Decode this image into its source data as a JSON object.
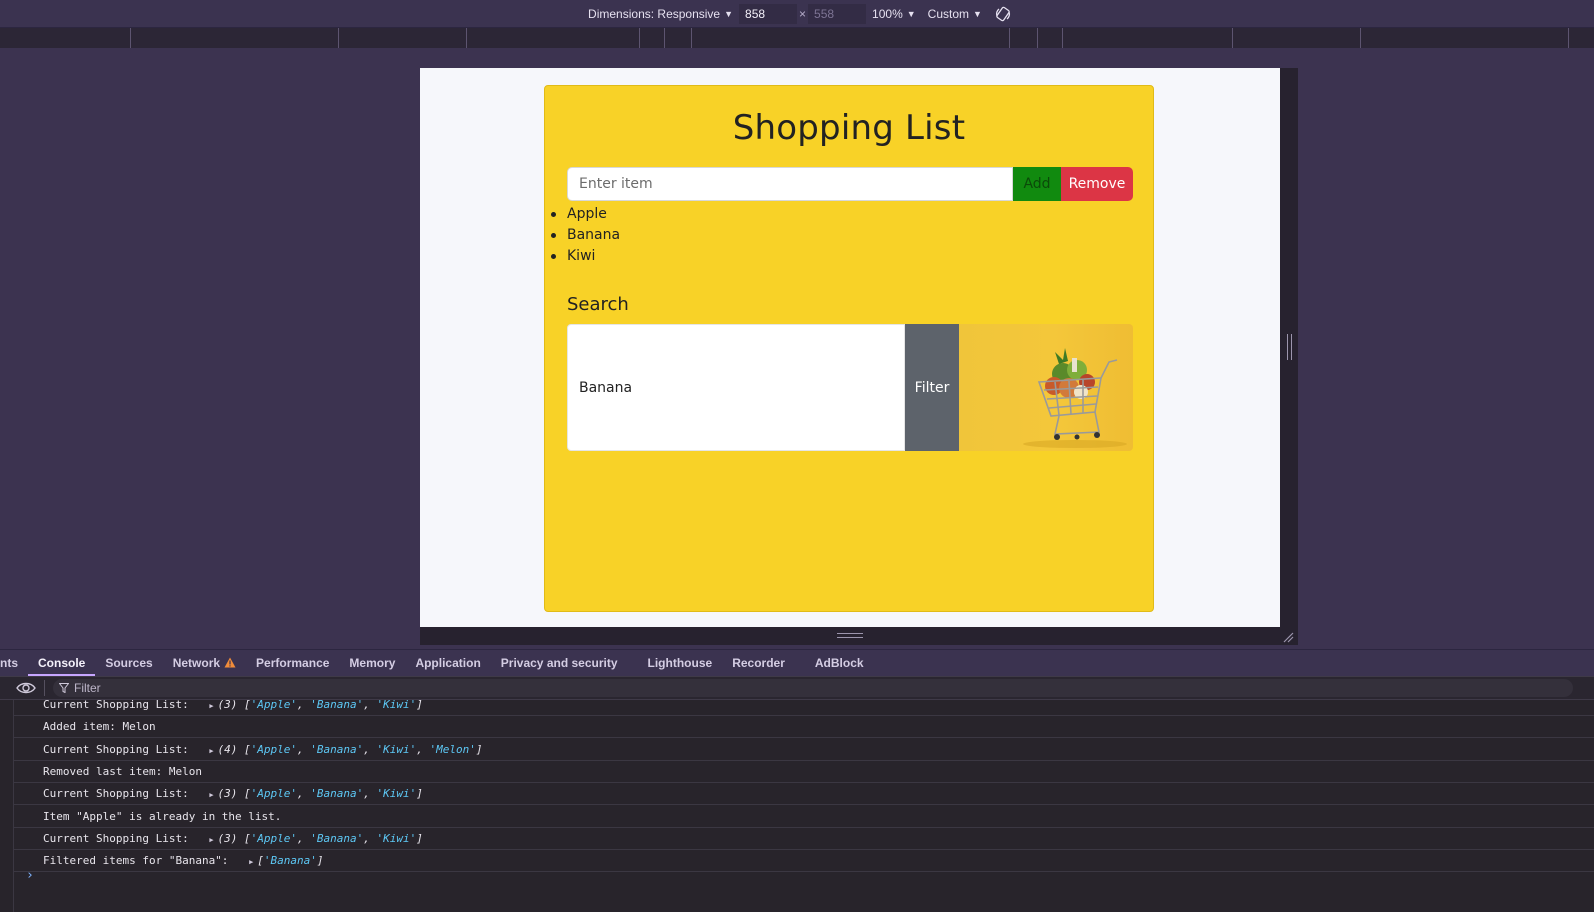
{
  "device_toolbar": {
    "dimensions_label": "Dimensions: Responsive",
    "width": "858",
    "height": "558",
    "times": "×",
    "zoom": "100%",
    "throttle": "Custom"
  },
  "page": {
    "title": "Shopping List",
    "item_input_placeholder": "Enter item",
    "add_label": "Add",
    "remove_label": "Remove",
    "items": [
      "Apple",
      "Banana",
      "Kiwi"
    ],
    "search_heading": "Search",
    "search_value": "Banana",
    "filter_label": "Filter"
  },
  "devtools": {
    "tabs": [
      "nts",
      "Console",
      "Sources",
      "Network",
      "Performance",
      "Memory",
      "Application",
      "Privacy and security",
      "Lighthouse",
      "Recorder",
      "AdBlock"
    ],
    "active_tab": "Console",
    "filter_placeholder": "Filter",
    "console": [
      {
        "text": "Current Shopping List: ",
        "arr": "(3) [",
        "items": [
          "'Apple'",
          "'Banana'",
          "'Kiwi'"
        ]
      },
      {
        "text": "Added item: Melon"
      },
      {
        "text": "Current Shopping List: ",
        "arr": "(4) [",
        "items": [
          "'Apple'",
          "'Banana'",
          "'Kiwi'",
          "'Melon'"
        ]
      },
      {
        "text": "Removed last item: Melon"
      },
      {
        "text": "Current Shopping List: ",
        "arr": "(3) [",
        "items": [
          "'Apple'",
          "'Banana'",
          "'Kiwi'"
        ]
      },
      {
        "text": "Item \"Apple\" is already in the list."
      },
      {
        "text": "Current Shopping List: ",
        "arr": "(3) [",
        "items": [
          "'Apple'",
          "'Banana'",
          "'Kiwi'"
        ]
      },
      {
        "text": "Filtered items for \"Banana\": ",
        "arr": "[",
        "items": [
          "'Banana'"
        ]
      }
    ],
    "prompt": "›"
  },
  "colors": {
    "card": "#f8d227",
    "add": "#118a0f",
    "remove": "#dc3545",
    "filter": "#5d636b"
  }
}
